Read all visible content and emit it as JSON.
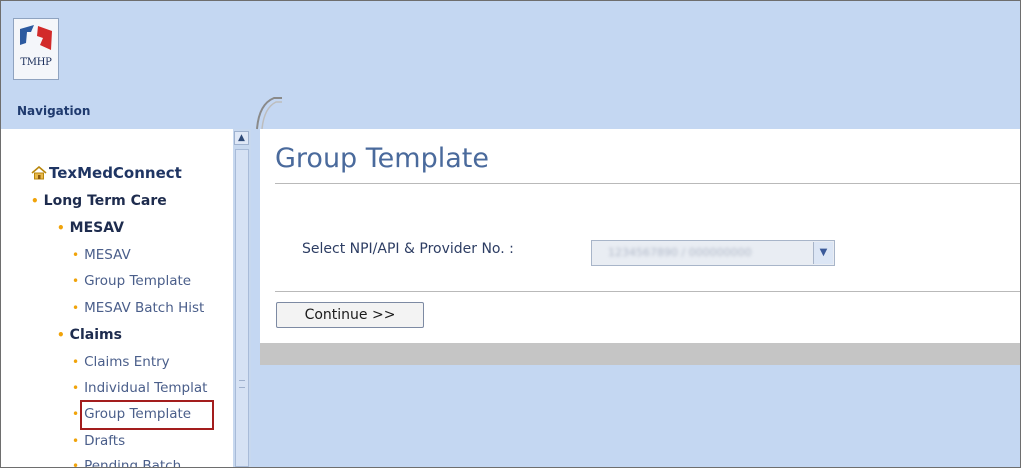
{
  "header": {
    "logo_text": "TMHP",
    "navigation_label": "Navigation"
  },
  "sidebar": {
    "root_label": "TexMedConnect",
    "items": [
      {
        "label": "Long Term Care"
      },
      {
        "label": "MESAV"
      },
      {
        "label": "MESAV"
      },
      {
        "label": "Group Template"
      },
      {
        "label": "MESAV Batch Hist"
      },
      {
        "label": "Claims"
      },
      {
        "label": "Claims Entry"
      },
      {
        "label": "Individual Templat"
      },
      {
        "label": "Group Template"
      },
      {
        "label": "Drafts"
      },
      {
        "label": "Pending Batch"
      }
    ]
  },
  "main": {
    "title": "Group Template",
    "select_label": "Select NPI/API & Provider No. :",
    "select_value": "1234567890 / 000000000",
    "continue_label": "Continue >>"
  },
  "colors": {
    "accent": "#4a6a9c",
    "background": "#c4d7f2",
    "bullet": "#f0a30a",
    "highlight": "#a31d1d"
  },
  "icons": [
    "home-icon",
    "chevron-down-icon",
    "scroll-up-arrow-icon"
  ]
}
